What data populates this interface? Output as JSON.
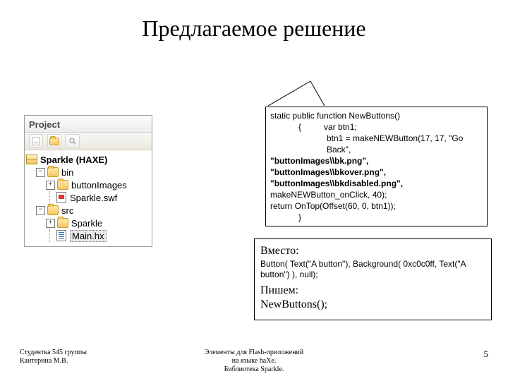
{
  "title": "Предлагаемое решение",
  "panel": {
    "header": "Project",
    "root": "Sparkle (HAXE)",
    "bin": "bin",
    "buttonImages": "buttonImages",
    "swf": "Sparkle.swf",
    "src": "src",
    "sparklePkg": "Sparkle",
    "main": "Main.hx"
  },
  "code": {
    "l1": "static public function NewButtons()",
    "l2a": "{",
    "l2b": "var btn1;",
    "l3": "btn1 = makeNEWButton(17, 17, \"Go Back\",",
    "l4": "\"buttonImages\\\\bk.png\",",
    "l5": "\"buttonImages\\\\bkover.png\",",
    "l6": "\"buttonImages\\\\bkdisabled.png\",",
    "l7": "makeNEWButton_onClick, 40);",
    "l8": "return OnTop(Offset(60, 0, btn1));",
    "l9": "}"
  },
  "instead": {
    "h1": "Вместо:",
    "c1": "Button( Text(\"A button\"), Background( 0xc0c0ff, Text(\"A button\") ), null);",
    "h2": "Пишем:",
    "c2": "NewButtons();"
  },
  "footer": {
    "left1": "Студентка 545 группы",
    "left2": "Кантерина М.В.",
    "c1": "Элементы для Flash-приложений",
    "c2": "на языке haXe.",
    "c3": "Библиотека Sparkle."
  },
  "slidenum": "5"
}
